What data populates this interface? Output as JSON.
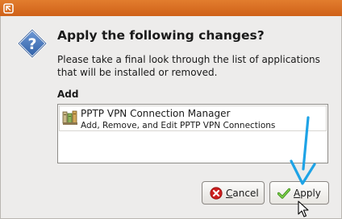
{
  "dialog": {
    "heading": "Apply the following changes?",
    "description": "Please take a final look through the list of applications that will be installed or removed.",
    "section_label": "Add",
    "icon": "question-icon"
  },
  "changes": {
    "add": [
      {
        "name": "PPTP VPN Connection Manager",
        "description": "Add, Remove, and Edit PPTP VPN Connections",
        "icon": "package-icon"
      }
    ]
  },
  "buttons": {
    "cancel": {
      "mnemonic": "C",
      "rest": "ancel",
      "icon": "cancel-icon"
    },
    "apply": {
      "mnemonic": "A",
      "rest": "pply",
      "icon": "checkmark-icon"
    }
  },
  "colors": {
    "titlebar": "#d96d22",
    "dialog_bg": "#edeceb",
    "annotation_arrow": "#1ea3e6",
    "question_icon": "#3b6fb3"
  }
}
